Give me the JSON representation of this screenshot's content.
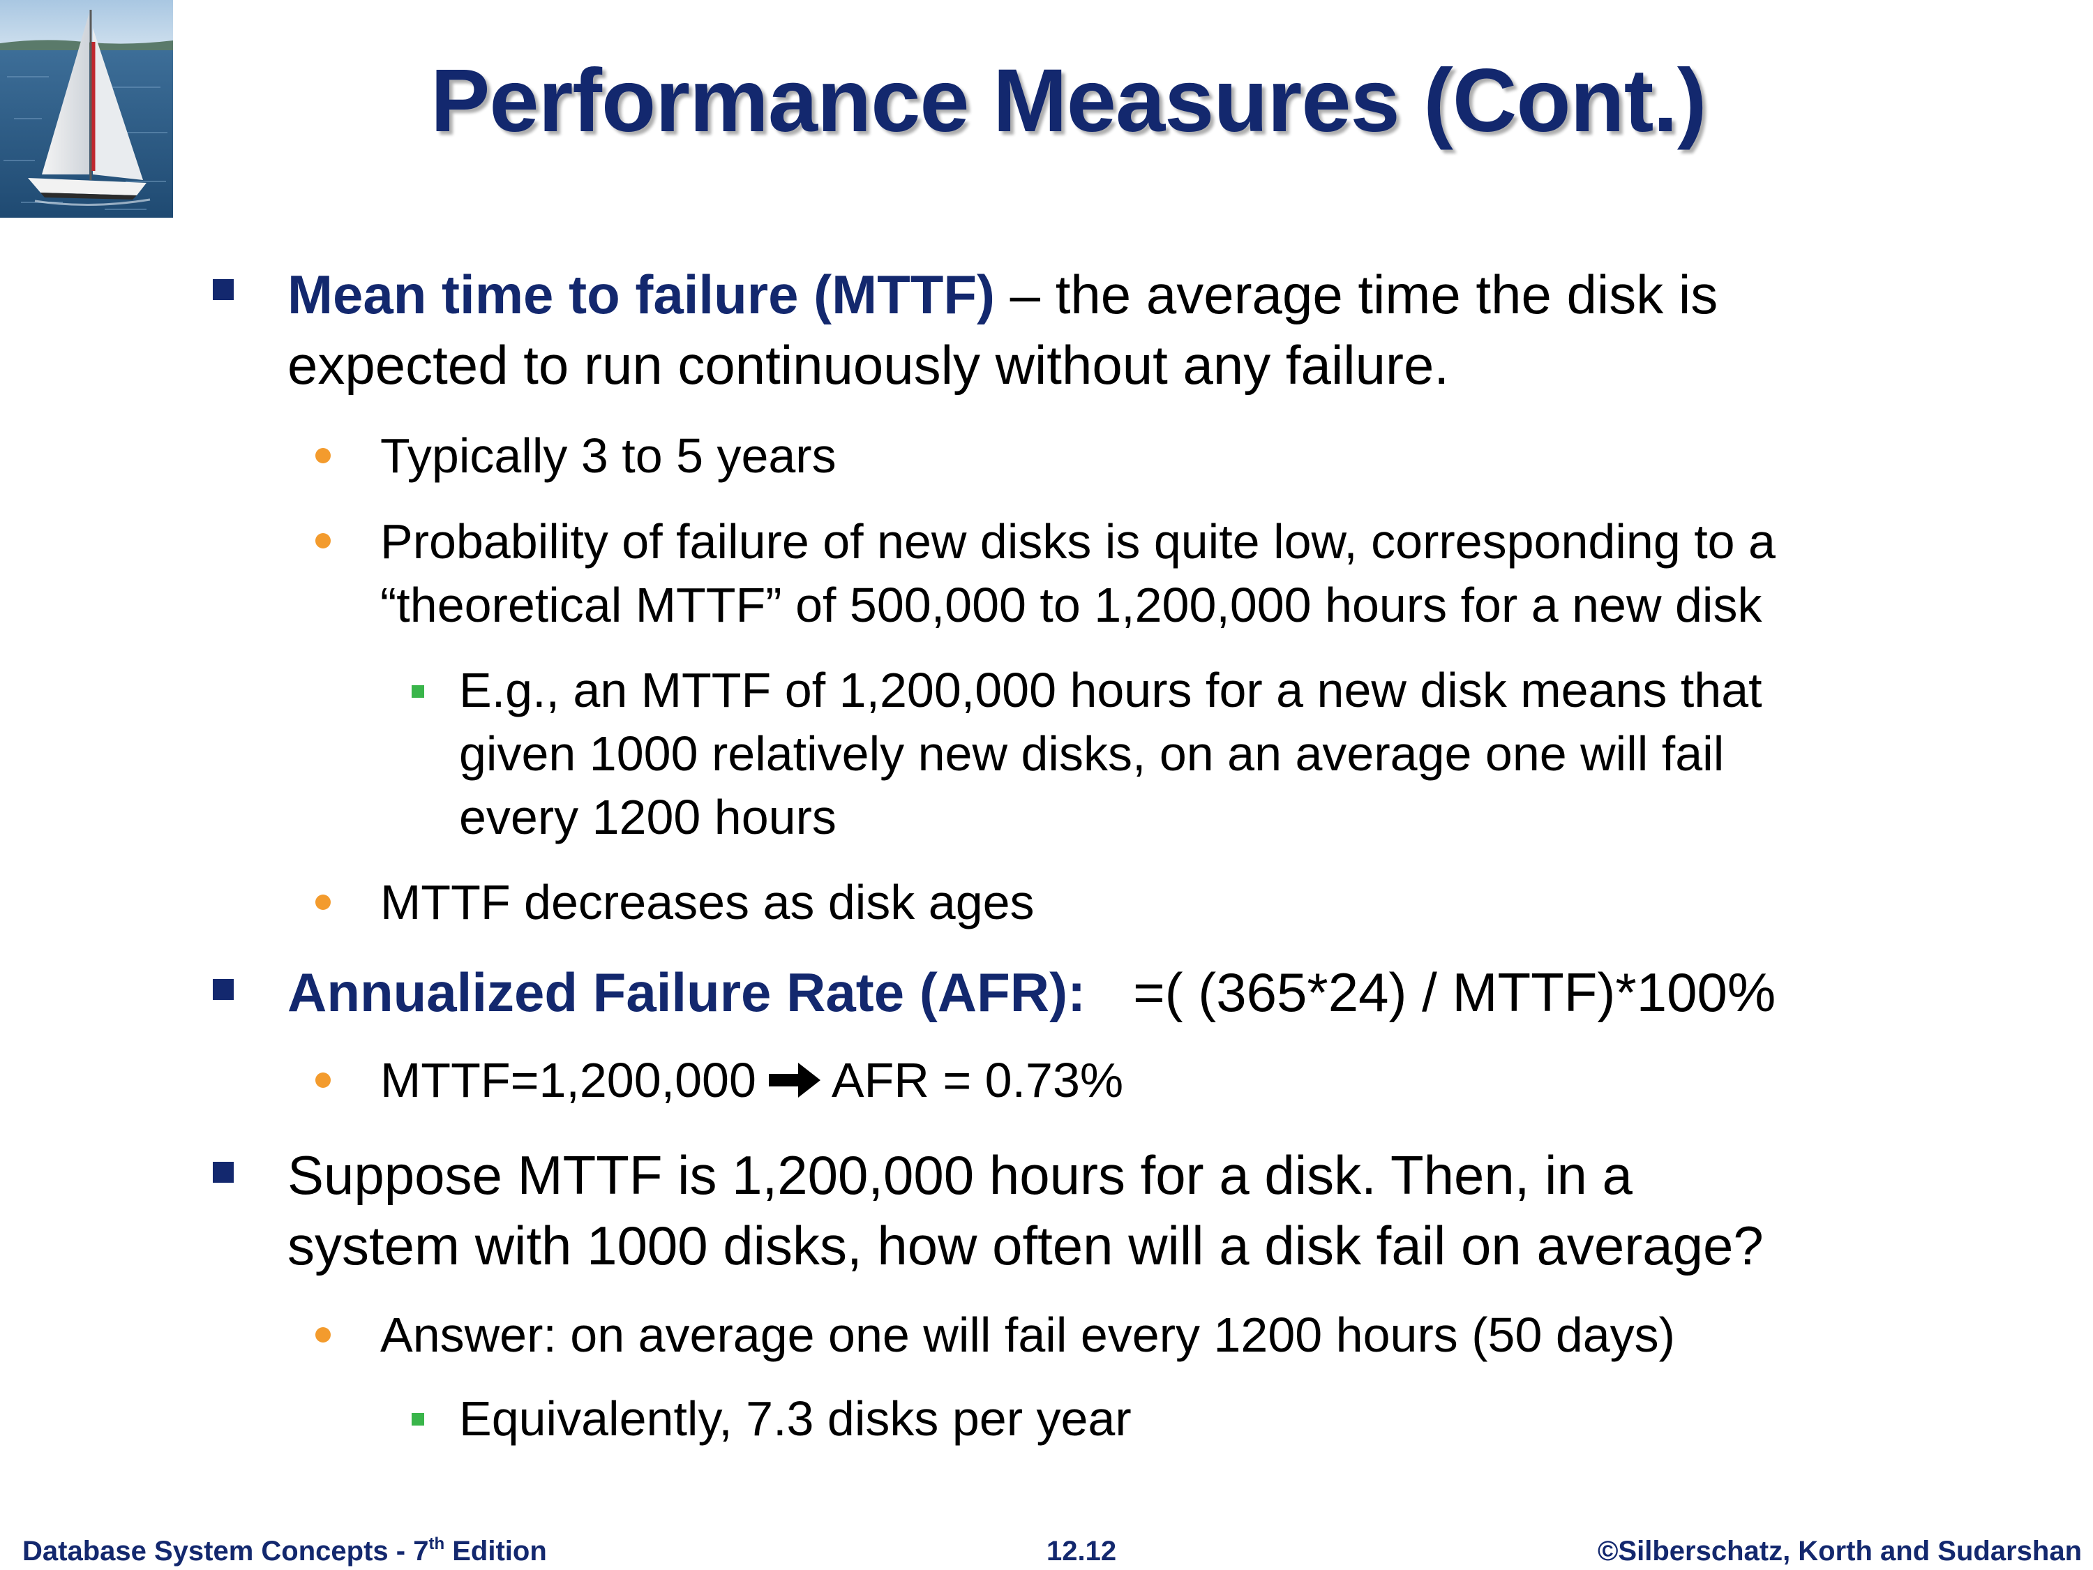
{
  "title": "Performance Measures (Cont.)",
  "bullets": {
    "mttf": {
      "term": "Mean time to failure (MTTF)",
      "line1_rest": " – the average time the disk is",
      "line2": "expected to run continuously without any failure."
    },
    "typically": "Typically 3 to 5 years",
    "probability": {
      "line1": "Probability of failure of new disks is quite low, corresponding to a",
      "line2": "“theoretical MTTF” of 500,000 to 1,200,000 hours for a new disk"
    },
    "example": {
      "line1": "E.g., an MTTF of 1,200,000 hours for a new disk means that",
      "line2": "given 1000 relatively new disks, on an average one will fail",
      "line3": "every 1200 hours"
    },
    "decreases": "MTTF decreases as disk ages",
    "afr": {
      "term": "Annualized Failure Rate (AFR):",
      "formula": "=( (365*24) / MTTF)*100%"
    },
    "afr_example": {
      "left": "MTTF=1,200,000",
      "right": "AFR = 0.73%"
    },
    "suppose": {
      "line1": "Suppose MTTF is 1,200,000 hours for a disk.  Then, in a",
      "line2": "system with 1000 disks, how often will a disk fail on average?"
    },
    "answer": "Answer: on average one will fail every 1200 hours (50 days)",
    "equivalently": "Equivalently, 7.3 disks per year"
  },
  "footer": {
    "book": "Database System Concepts - 7",
    "edition_sup": "th",
    "edition_rest": " Edition",
    "page": "12.12",
    "copyright": "©Silberschatz, Korth and Sudarshan"
  },
  "colors": {
    "title": "#13286e",
    "level1_bullet": "#13286e",
    "level2_bullet": "#f39b2d",
    "level3_bullet": "#39b54a"
  },
  "icons": {
    "logo": "sailboat-logo",
    "arrow": "implies-arrow-icon"
  }
}
